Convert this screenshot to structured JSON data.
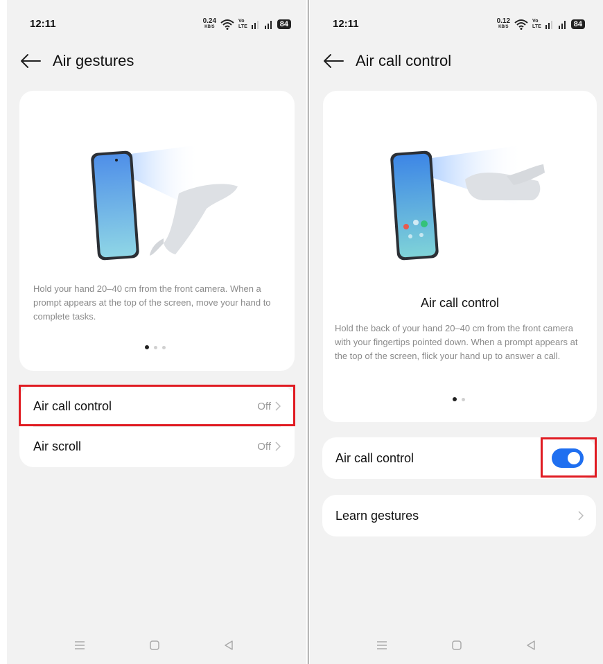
{
  "left": {
    "status": {
      "time": "12:11",
      "net_speed": "0.24",
      "net_unit": "KB/S",
      "volte_top": "Vo",
      "volte_bottom": "LTE",
      "battery": "84"
    },
    "header": {
      "title": "Air gestures"
    },
    "illustration": {
      "description": "Hold your hand 20–40 cm from the front camera. When a prompt appears at the top of the screen, move your hand to complete tasks.",
      "pager": {
        "total": 3,
        "active": 1
      }
    },
    "settings": [
      {
        "label": "Air call control",
        "value": "Off"
      },
      {
        "label": "Air scroll",
        "value": "Off"
      }
    ]
  },
  "right": {
    "status": {
      "time": "12:11",
      "net_speed": "0.12",
      "net_unit": "KB/S",
      "volte_top": "Vo",
      "volte_bottom": "LTE",
      "battery": "84"
    },
    "header": {
      "title": "Air call control"
    },
    "illustration": {
      "title": "Air call control",
      "description": "Hold the back of your hand 20–40 cm from the front camera with your fingertips pointed down. When a prompt appears at the top of the screen, flick your hand up to answer a call.",
      "pager": {
        "total": 2,
        "active": 1
      }
    },
    "toggle_row": {
      "label": "Air call control",
      "enabled": true
    },
    "learn_row": {
      "label": "Learn gestures"
    }
  },
  "colors": {
    "accent": "#1f6ff0",
    "highlight": "#e01b22",
    "background": "#f2f2f2"
  },
  "icons": [
    "back-arrow-icon",
    "wifi-icon",
    "signal-icon",
    "battery-icon",
    "chevron-right-icon",
    "menu-icon",
    "home-icon",
    "back-icon"
  ]
}
